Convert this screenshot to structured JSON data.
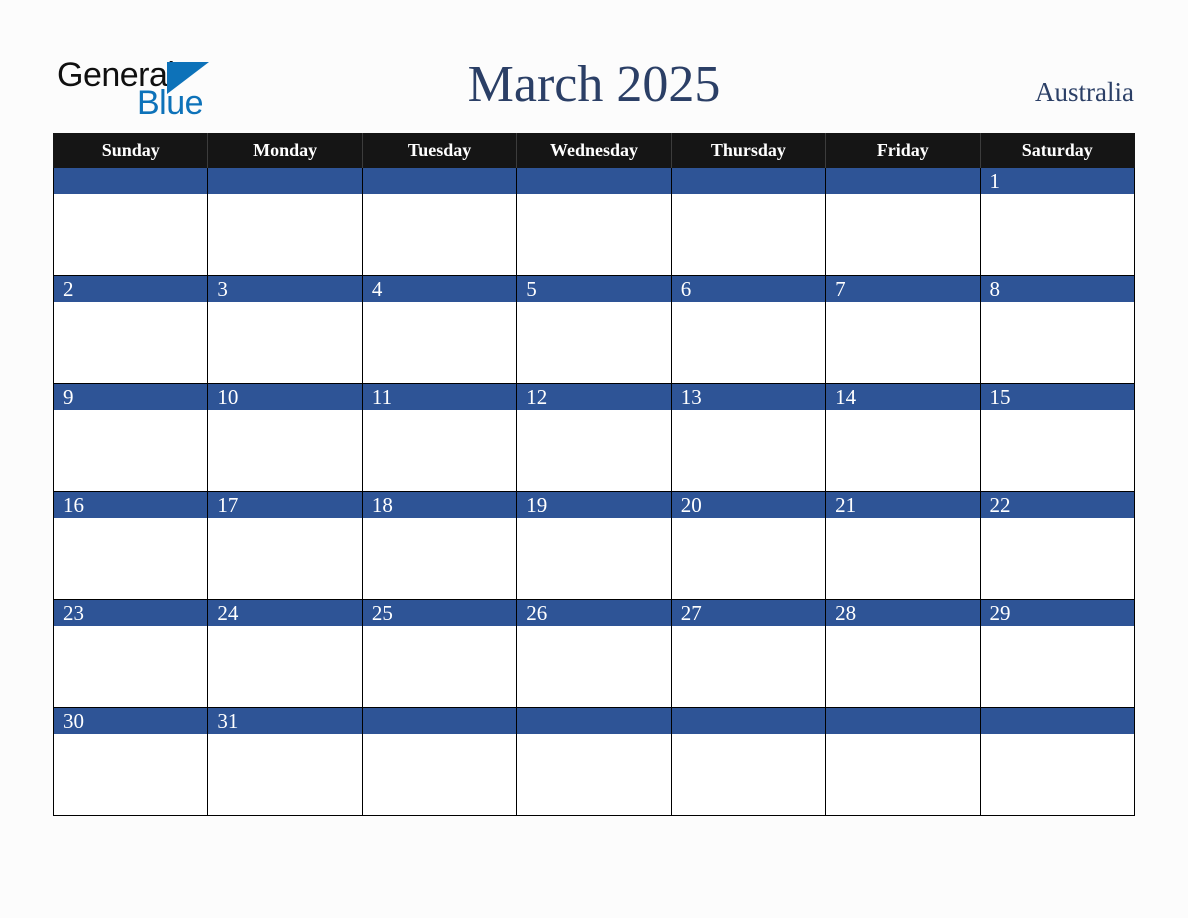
{
  "brand": {
    "word_one": "General",
    "word_two": "Blue",
    "triangle_icon": "triangle-icon",
    "color_dark": "#101010",
    "color_blue": "#0d72b9"
  },
  "header": {
    "title": "March 2025",
    "region": "Australia",
    "title_color": "#2b3f66"
  },
  "calendar": {
    "header_bg": "#151515",
    "daynum_bg": "#2e5496",
    "cell_bg": "#ffffff",
    "weekdays": [
      "Sunday",
      "Monday",
      "Tuesday",
      "Wednesday",
      "Thursday",
      "Friday",
      "Saturday"
    ],
    "weeks": [
      [
        "",
        "",
        "",
        "",
        "",
        "",
        "1"
      ],
      [
        "2",
        "3",
        "4",
        "5",
        "6",
        "7",
        "8"
      ],
      [
        "9",
        "10",
        "11",
        "12",
        "13",
        "14",
        "15"
      ],
      [
        "16",
        "17",
        "18",
        "19",
        "20",
        "21",
        "22"
      ],
      [
        "23",
        "24",
        "25",
        "26",
        "27",
        "28",
        "29"
      ],
      [
        "30",
        "31",
        "",
        "",
        "",
        "",
        ""
      ]
    ]
  }
}
